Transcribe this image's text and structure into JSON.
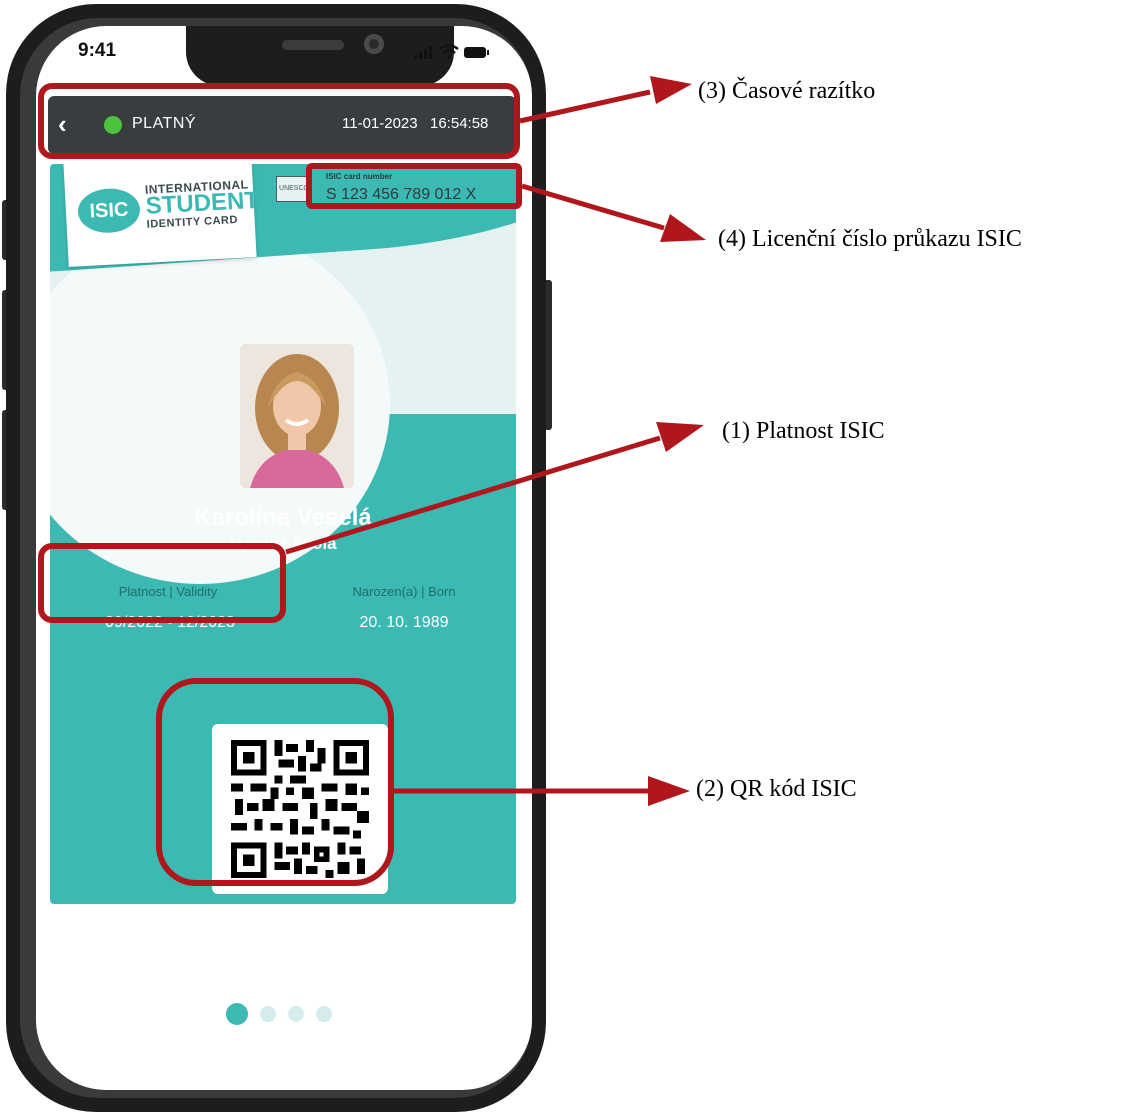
{
  "status_bar": {
    "time": "9:41"
  },
  "header": {
    "back_icon": "chevron-left-icon",
    "status": "PLATNÝ",
    "status_color": "#4cc23e",
    "date": "11-01-2023",
    "time": "16:54:58"
  },
  "card": {
    "logo": {
      "badge": "ISIC",
      "line1": "INTERNATIONAL",
      "line2": "STUDENT",
      "line3": "IDENTITY CARD"
    },
    "unesco": "UNESCO",
    "card_number_label": "ISIC card number",
    "card_number": "S 123 456 789 012 X",
    "name": "Karolína Veselá",
    "school": "Vysoká škola",
    "validity_label": "Platnost | Validity",
    "validity_value": "09/2022 - 12/2023",
    "born_label": "Narozen(a) | Born",
    "born_value": "20. 10. 1989",
    "accent_color": "#3cb9b2"
  },
  "pager": {
    "count": 4,
    "active": 1
  },
  "annotations": {
    "timestamp": "(3) Časové razítko",
    "card_number": "(4) Licenční číslo průkazu ISIC",
    "validity": "(1) Platnost ISIC",
    "qr": "(2) QR kód ISIC",
    "highlight_color": "#b0171d"
  }
}
